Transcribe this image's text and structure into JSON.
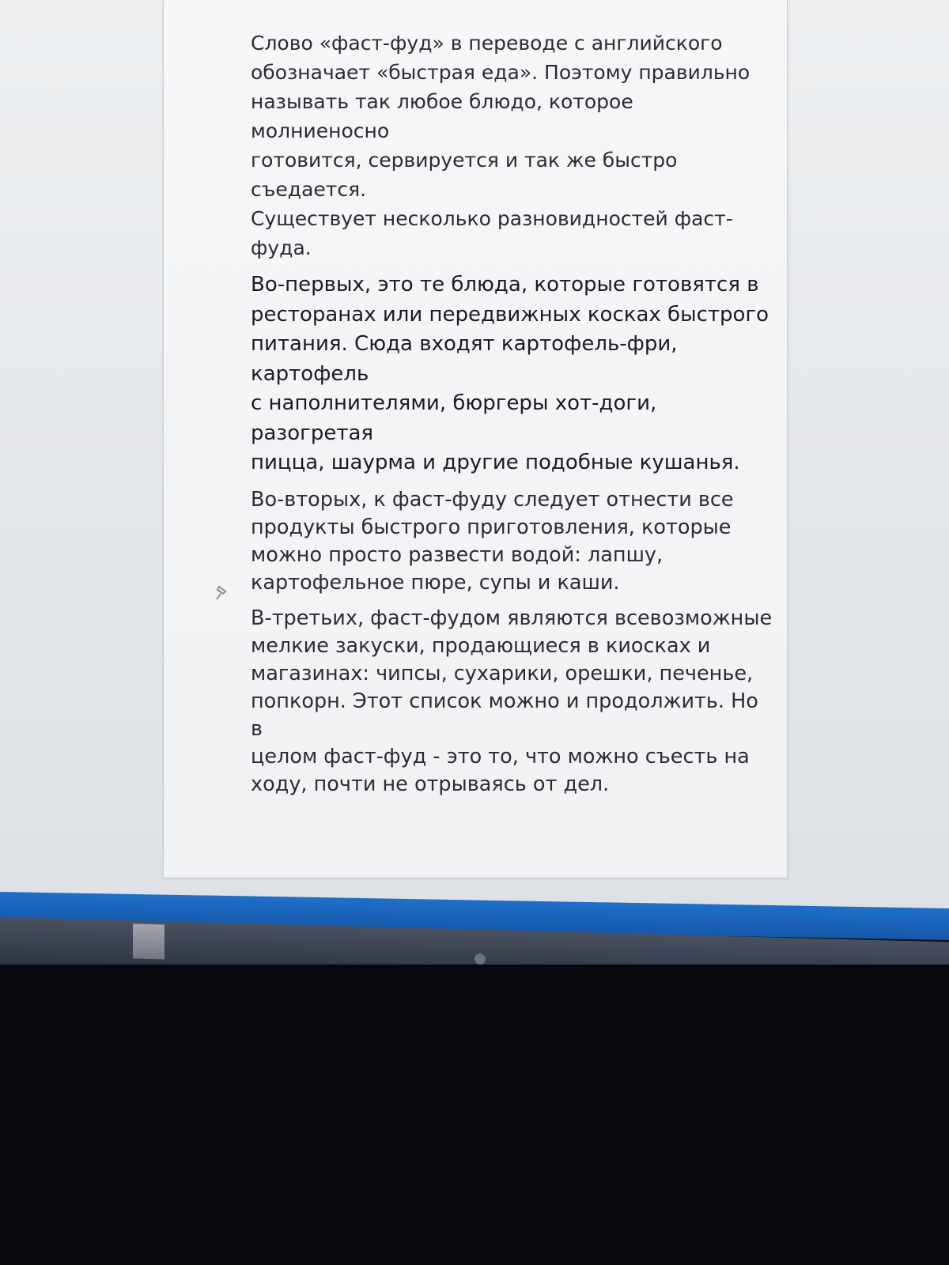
{
  "document": {
    "paragraphs": [
      "Слово «фаст-фуд» в переводе с английского\nобозначает «быстрая еда». Поэтому правильно\nназывать так любое блюдо, которое молниеносно\nготовится, сервируется и так же быстро съедается.\nСуществует несколько разновидностей фаст-фуда.",
      "Во-первых, это те блюда, которые готовятся в\nресторанах или передвижных косках быстрого\nпитания. Сюда входят картофель-фри, картофель\nс наполнителями, бюргеры хот-доги, разогретая\nпицца, шаурма и другие подобные кушанья.",
      "Во-вторых, к фаст-фуду следует отнести все\nпродукты быстрого приготовления, которые\nможно просто развести водой: лапшу,\nкартофельное пюре, супы и каши.",
      "В-третьих, фаст-фудом являются всевозможные\nмелкие закуски, продающиеся в киосках и\nмагазинах: чипсы, сухарики, орешки, печенье,\nпопкорн. Этот список можно и продолжить. Но в\nцелом фаст-фуд - это то, что можно съесть на\nходу, почти не отрываясь от дел."
    ]
  },
  "colors": {
    "taskbar_accent": "#1f6fc9",
    "page_background": "#f3f5f6",
    "text": "#2a2c31"
  },
  "icons": {
    "paragraph_marker": "pushpin-icon"
  }
}
